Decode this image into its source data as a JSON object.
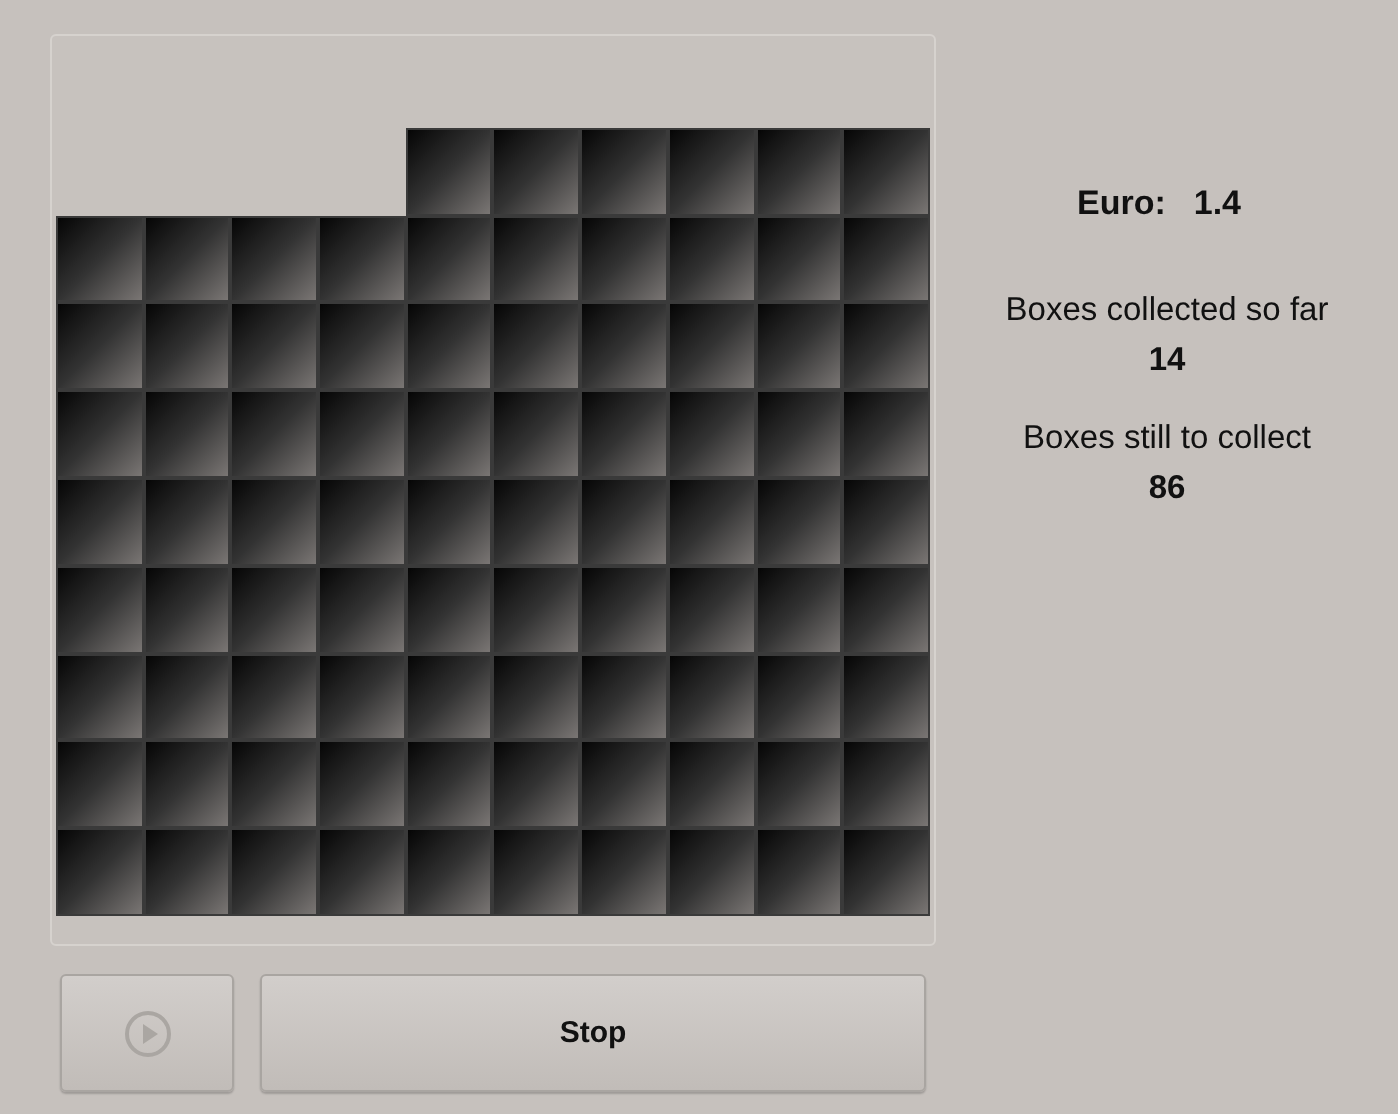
{
  "grid": {
    "rows": [
      {
        "boxes": [
          {
            "collected": true
          },
          {
            "collected": true
          },
          {
            "collected": true
          },
          {
            "collected": true
          },
          {
            "collected": true
          },
          {
            "collected": true
          },
          {
            "collected": true
          },
          {
            "collected": true
          },
          {
            "collected": true
          },
          {
            "collected": true
          }
        ]
      },
      {
        "boxes": [
          {
            "collected": true
          },
          {
            "collected": true
          },
          {
            "collected": true
          },
          {
            "collected": true
          },
          {
            "collected": false
          },
          {
            "collected": false
          },
          {
            "collected": false
          },
          {
            "collected": false
          },
          {
            "collected": false
          },
          {
            "collected": false
          }
        ]
      },
      {
        "boxes": [
          {
            "collected": false
          },
          {
            "collected": false
          },
          {
            "collected": false
          },
          {
            "collected": false
          },
          {
            "collected": false
          },
          {
            "collected": false
          },
          {
            "collected": false
          },
          {
            "collected": false
          },
          {
            "collected": false
          },
          {
            "collected": false
          }
        ]
      },
      {
        "boxes": [
          {
            "collected": false
          },
          {
            "collected": false
          },
          {
            "collected": false
          },
          {
            "collected": false
          },
          {
            "collected": false
          },
          {
            "collected": false
          },
          {
            "collected": false
          },
          {
            "collected": false
          },
          {
            "collected": false
          },
          {
            "collected": false
          }
        ]
      },
      {
        "boxes": [
          {
            "collected": false
          },
          {
            "collected": false
          },
          {
            "collected": false
          },
          {
            "collected": false
          },
          {
            "collected": false
          },
          {
            "collected": false
          },
          {
            "collected": false
          },
          {
            "collected": false
          },
          {
            "collected": false
          },
          {
            "collected": false
          }
        ]
      },
      {
        "boxes": [
          {
            "collected": false
          },
          {
            "collected": false
          },
          {
            "collected": false
          },
          {
            "collected": false
          },
          {
            "collected": false
          },
          {
            "collected": false
          },
          {
            "collected": false
          },
          {
            "collected": false
          },
          {
            "collected": false
          },
          {
            "collected": false
          }
        ]
      },
      {
        "boxes": [
          {
            "collected": false
          },
          {
            "collected": false
          },
          {
            "collected": false
          },
          {
            "collected": false
          },
          {
            "collected": false
          },
          {
            "collected": false
          },
          {
            "collected": false
          },
          {
            "collected": false
          },
          {
            "collected": false
          },
          {
            "collected": false
          }
        ]
      },
      {
        "boxes": [
          {
            "collected": false
          },
          {
            "collected": false
          },
          {
            "collected": false
          },
          {
            "collected": false
          },
          {
            "collected": false
          },
          {
            "collected": false
          },
          {
            "collected": false
          },
          {
            "collected": false
          },
          {
            "collected": false
          },
          {
            "collected": false
          }
        ]
      },
      {
        "boxes": [
          {
            "collected": false
          },
          {
            "collected": false
          },
          {
            "collected": false
          },
          {
            "collected": false
          },
          {
            "collected": false
          },
          {
            "collected": false
          },
          {
            "collected": false
          },
          {
            "collected": false
          },
          {
            "collected": false
          },
          {
            "collected": false
          }
        ]
      },
      {
        "boxes": [
          {
            "collected": false
          },
          {
            "collected": false
          },
          {
            "collected": false
          },
          {
            "collected": false
          },
          {
            "collected": false
          },
          {
            "collected": false
          },
          {
            "collected": false
          },
          {
            "collected": false
          },
          {
            "collected": false
          },
          {
            "collected": false
          }
        ]
      }
    ]
  },
  "play_button": {
    "disabled": true
  },
  "stop_button": {
    "label": "Stop",
    "disabled": false
  },
  "euro": {
    "label": "Euro:",
    "value": "1.4"
  },
  "collected": {
    "label": "Boxes collected so far",
    "value": "14"
  },
  "remaining": {
    "label": "Boxes still to collect",
    "value": "86"
  }
}
